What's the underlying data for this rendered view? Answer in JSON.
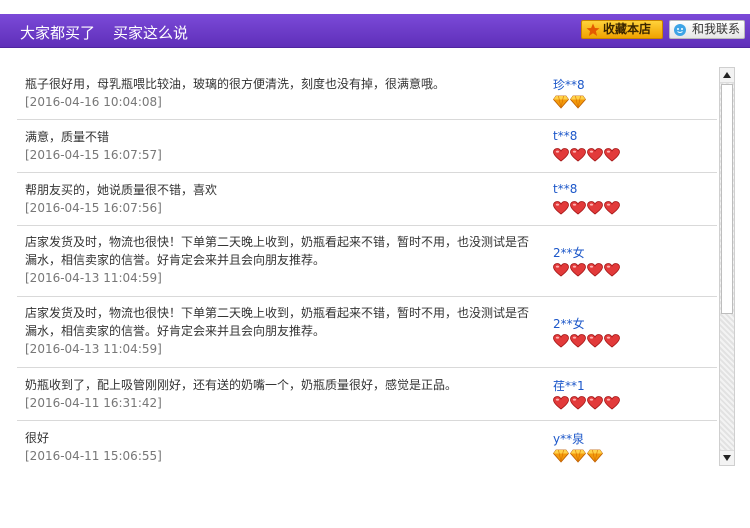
{
  "tabs": [
    {
      "label": "大家都买了"
    },
    {
      "label": "买家这么说"
    }
  ],
  "header_buttons": {
    "favorite": "收藏本店",
    "contact": "和我联系"
  },
  "colors": {
    "header_purple": "#6a3ac8",
    "link_blue": "#1c57c9",
    "heart_red": "#e23a3a",
    "diamond_orange": "#f39a0c"
  },
  "reviews": [
    {
      "text": "瓶子很好用，母乳瓶喂比较油，玻璃的很方便清洗，刻度也没有掉，很满意哦。",
      "date": "[2016-04-16 10:04:08]",
      "user": "珍**8",
      "rank_icon": "diamond",
      "rank_count": 2
    },
    {
      "text": "满意，质量不错",
      "date": "[2016-04-15 16:07:57]",
      "user": "t**8",
      "rank_icon": "heart",
      "rank_count": 4
    },
    {
      "text": "帮朋友买的，她说质量很不错，喜欢",
      "date": "[2016-04-15 16:07:56]",
      "user": "t**8",
      "rank_icon": "heart",
      "rank_count": 4
    },
    {
      "text": "店家发货及时，物流也很快！下单第二天晚上收到，奶瓶看起来不错，暂时不用，也没测试是否漏水，相信卖家的信誉。好肯定会来并且会向朋友推荐。",
      "date": "[2016-04-13 11:04:59]",
      "user": "2**女",
      "rank_icon": "heart",
      "rank_count": 4
    },
    {
      "text": "店家发货及时，物流也很快！下单第二天晚上收到，奶瓶看起来不错，暂时不用，也没测试是否漏水，相信卖家的信誉。好肯定会来并且会向朋友推荐。",
      "date": "[2016-04-13 11:04:59]",
      "user": "2**女",
      "rank_icon": "heart",
      "rank_count": 4
    },
    {
      "text": "奶瓶收到了，配上吸管刚刚好，还有送的奶嘴一个，奶瓶质量很好，感觉是正品。",
      "date": "[2016-04-11 16:31:42]",
      "user": "荏**1",
      "rank_icon": "heart",
      "rank_count": 4
    },
    {
      "text": "很好",
      "date": "[2016-04-11 15:06:55]",
      "user": "y**泉",
      "rank_icon": "diamond",
      "rank_count": 3
    }
  ]
}
